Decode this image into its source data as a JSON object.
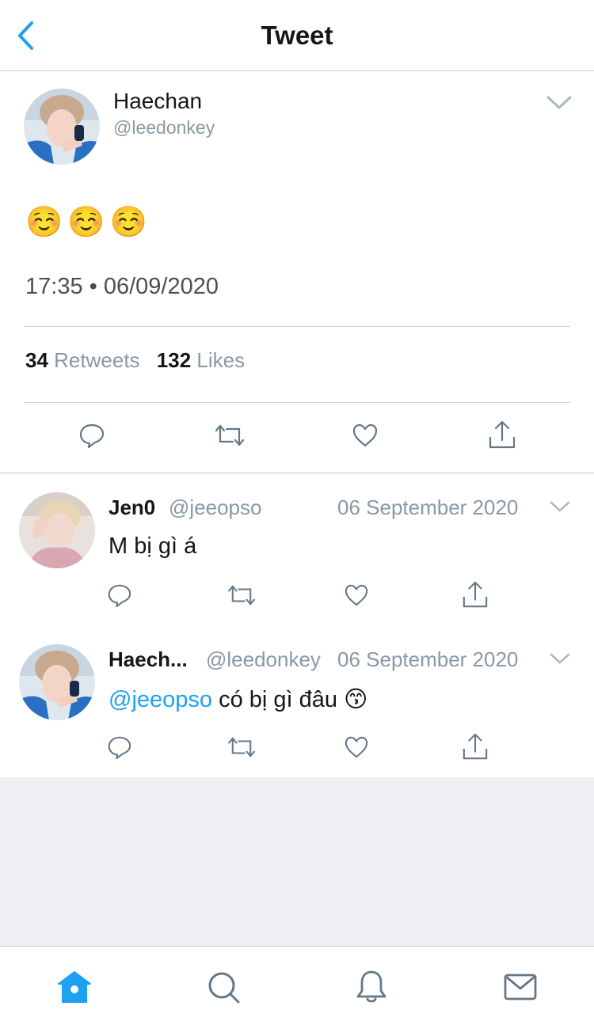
{
  "header": {
    "title": "Tweet"
  },
  "main_tweet": {
    "name": "Haechan",
    "handle": "@leedonkey",
    "text": "☺️☺️☺️",
    "timestamp": "17:35 • 06/09/2020",
    "retweets_count": "34",
    "retweets_label": "Retweets",
    "likes_count": "132",
    "likes_label": "Likes"
  },
  "replies": [
    {
      "name": "Jen0",
      "handle": "@jeeopso",
      "date": "06 September 2020",
      "text": "M bị gì á"
    },
    {
      "name": "Haech...",
      "handle": "@leedonkey",
      "date": "06 September 2020",
      "mention": "@jeeopso",
      "text": " có bị gì đâu 😙"
    }
  ],
  "tabbar": [
    "home-icon",
    "search-icon",
    "bell-icon",
    "mail-icon"
  ],
  "colors": {
    "accent": "#1da1f2",
    "secondary_text": "#8899a6",
    "icon_gray": "#657786",
    "background_gray": "#efeff4"
  }
}
